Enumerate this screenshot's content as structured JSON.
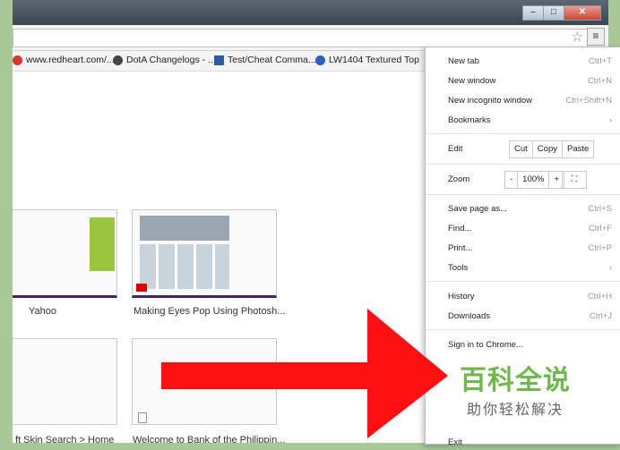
{
  "bookmarks": [
    {
      "label": "www.redheart.com/...",
      "color": "#d33"
    },
    {
      "label": "DotA Changelogs - ...",
      "color": "#444"
    },
    {
      "label": "Test/Cheat Comma...",
      "color": "#2a5aa0"
    },
    {
      "label": "LW1404 Textured Top",
      "color": "#2b5fc0"
    }
  ],
  "tiles": [
    {
      "label": "Yahoo"
    },
    {
      "label": "Making Eyes Pop Using Photosh..."
    },
    {
      "label": "ft Skin Search > Home"
    },
    {
      "label": "Welcome to Bank of the Philippin..."
    }
  ],
  "menu": {
    "new_tab": "New tab",
    "new_tab_sc": "Ctrl+T",
    "new_window": "New window",
    "new_window_sc": "Ctrl+N",
    "incognito": "New incognito window",
    "incognito_sc": "Ctrl+Shift+N",
    "bookmarks": "Bookmarks",
    "edit": "Edit",
    "cut": "Cut",
    "copy": "Copy",
    "paste": "Paste",
    "zoom": "Zoom",
    "zoom_minus": "-",
    "zoom_value": "100%",
    "zoom_plus": "+",
    "save_page": "Save page as...",
    "save_page_sc": "Ctrl+S",
    "find": "Find...",
    "find_sc": "Ctrl+F",
    "print": "Print...",
    "print_sc": "Ctrl+P",
    "tools": "Tools",
    "history": "History",
    "history_sc": "Ctrl+H",
    "downloads": "Downloads",
    "downloads_sc": "Ctrl+J",
    "sign_in": "Sign in to Chrome...",
    "exit": "Exit"
  },
  "watermark": {
    "title": "百科全说",
    "subtitle": "助你轻松解决"
  },
  "colors": {
    "arrow": "#ff1010",
    "watermark": "#6fb84d"
  }
}
